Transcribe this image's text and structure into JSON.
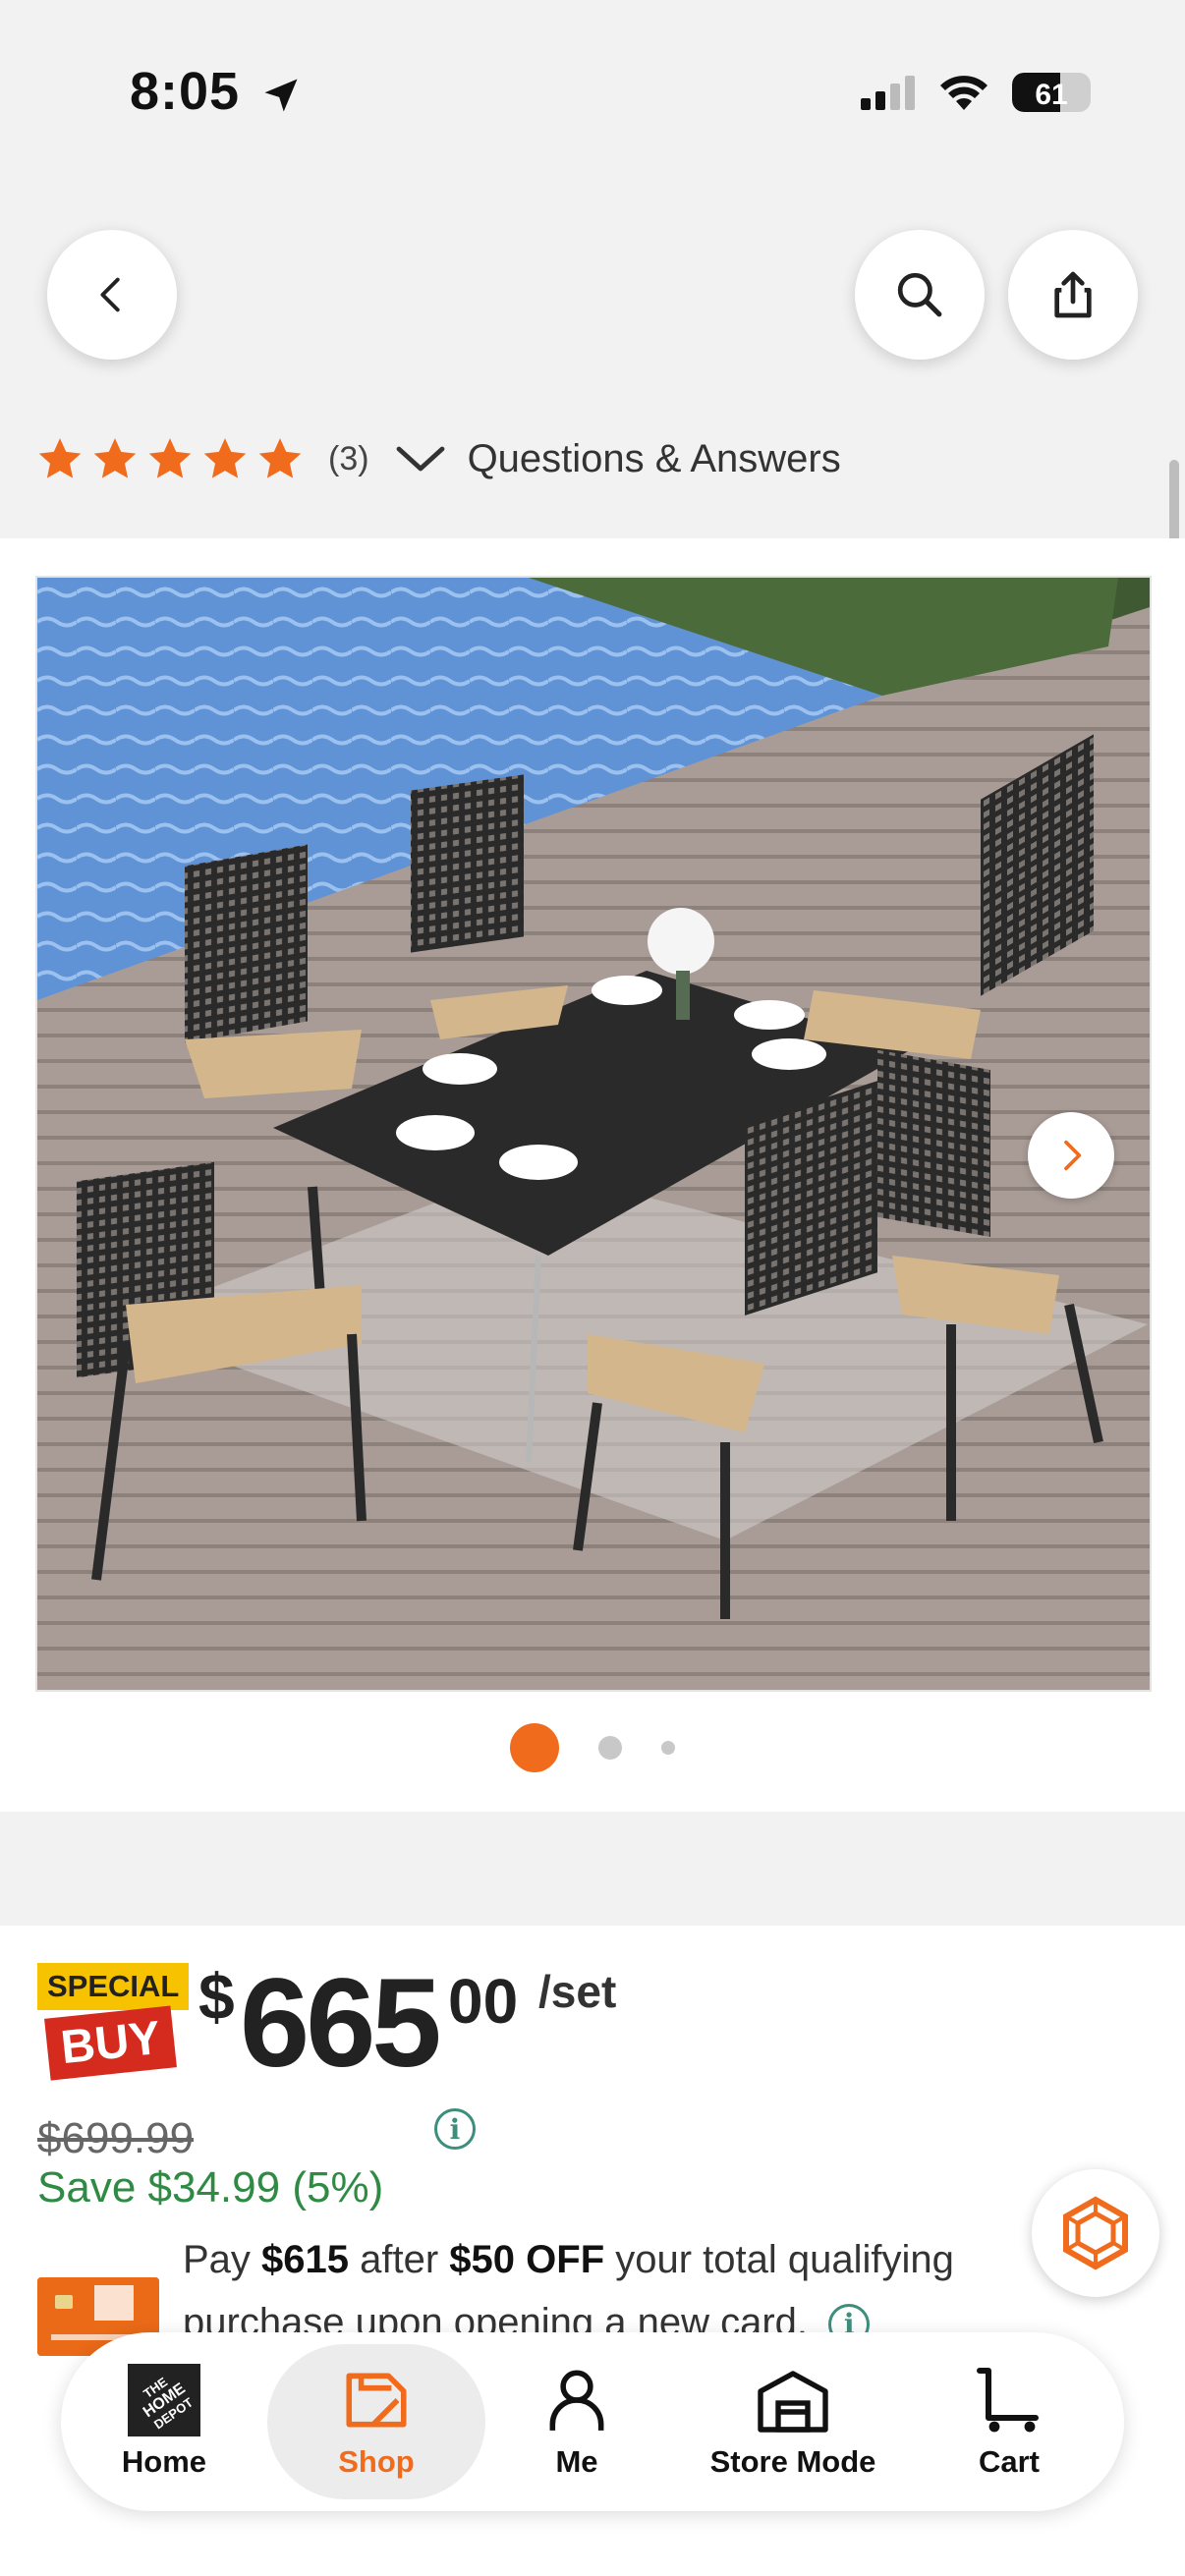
{
  "status_bar": {
    "time": "8:05",
    "battery": "61",
    "battery_level": 0.61
  },
  "nav": {
    "back_icon": "chevron-left-icon",
    "search_icon": "search-icon",
    "share_icon": "share-icon"
  },
  "rating": {
    "stars": 5,
    "count": "(3)",
    "qa_label": "Questions & Answers"
  },
  "gallery": {
    "image_description_icon": "patio-dining-set-photo",
    "active_index": 0,
    "total": 3
  },
  "price": {
    "badge_special": "SPECIAL",
    "badge_buy": "BUY",
    "currency": "$",
    "dollars": "665",
    "cents": "00",
    "unit": "/set",
    "was": "$699.99",
    "info_icon": "i",
    "save": "Save $34.99 (5%)"
  },
  "promo": {
    "pre": "Pay ",
    "pay_amount": "$615",
    "mid": " after ",
    "off": "$50 OFF",
    "post": " your total qualifying purchase upon opening a new card.",
    "info_icon": "i"
  },
  "tabs": [
    {
      "label": "Home",
      "icon": "home-depot-logo-icon"
    },
    {
      "label": "Shop",
      "icon": "shop-tag-icon",
      "active": true
    },
    {
      "label": "Me",
      "icon": "person-icon"
    },
    {
      "label": "Store Mode",
      "icon": "store-icon"
    },
    {
      "label": "Cart",
      "icon": "cart-icon"
    }
  ],
  "colors": {
    "accent": "#f06c1c",
    "save_green": "#2f8a43",
    "info_teal": "#3e8e7e",
    "special_yellow": "#f7c200",
    "buy_red": "#d52b1e"
  }
}
